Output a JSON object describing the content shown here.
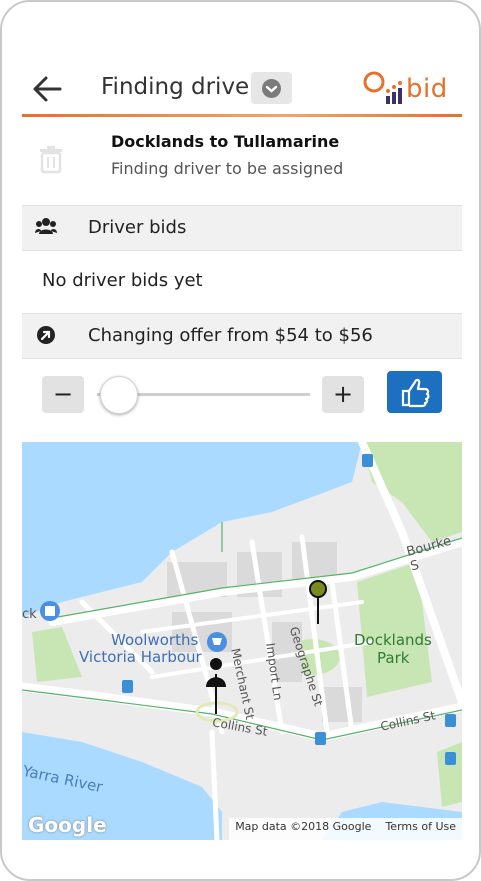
{
  "header": {
    "title": "Finding driver",
    "logo_text": "bid",
    "back_icon": "arrow-left-icon",
    "dropdown_icon": "chevron-down-icon"
  },
  "trip": {
    "route": "Docklands to Tullamarine",
    "status": "Finding driver to be assigned",
    "delete_icon": "trash-icon"
  },
  "bids": {
    "section_label": "Driver bids",
    "empty_text": "No driver bids yet"
  },
  "offer": {
    "label": "Changing offer from $54 to $56",
    "minus": "−",
    "plus": "+",
    "slider_value": 0.1
  },
  "map": {
    "labels": {
      "bourke": "Bourke S",
      "geographe": "Geographe St",
      "docklands_park_1": "Docklands",
      "docklands_park_2": "Park",
      "woolworths_1": "Woolworths",
      "woolworths_2": "Victoria Harbour",
      "merchant": "Merchant St",
      "import": "Import Ln",
      "collins_left": "Collins St",
      "collins_right": "Collins St",
      "yarra": "Yarra River",
      "dock": "ck"
    },
    "google": "Google",
    "attribution": "Map data ©2018 Google",
    "terms": "Terms of Use"
  },
  "colors": {
    "accent": "#e7712a",
    "like_button": "#1d6fbf",
    "water": "#aadaff",
    "park": "#c8e6b4",
    "pin_green": "#7a8b1f"
  }
}
